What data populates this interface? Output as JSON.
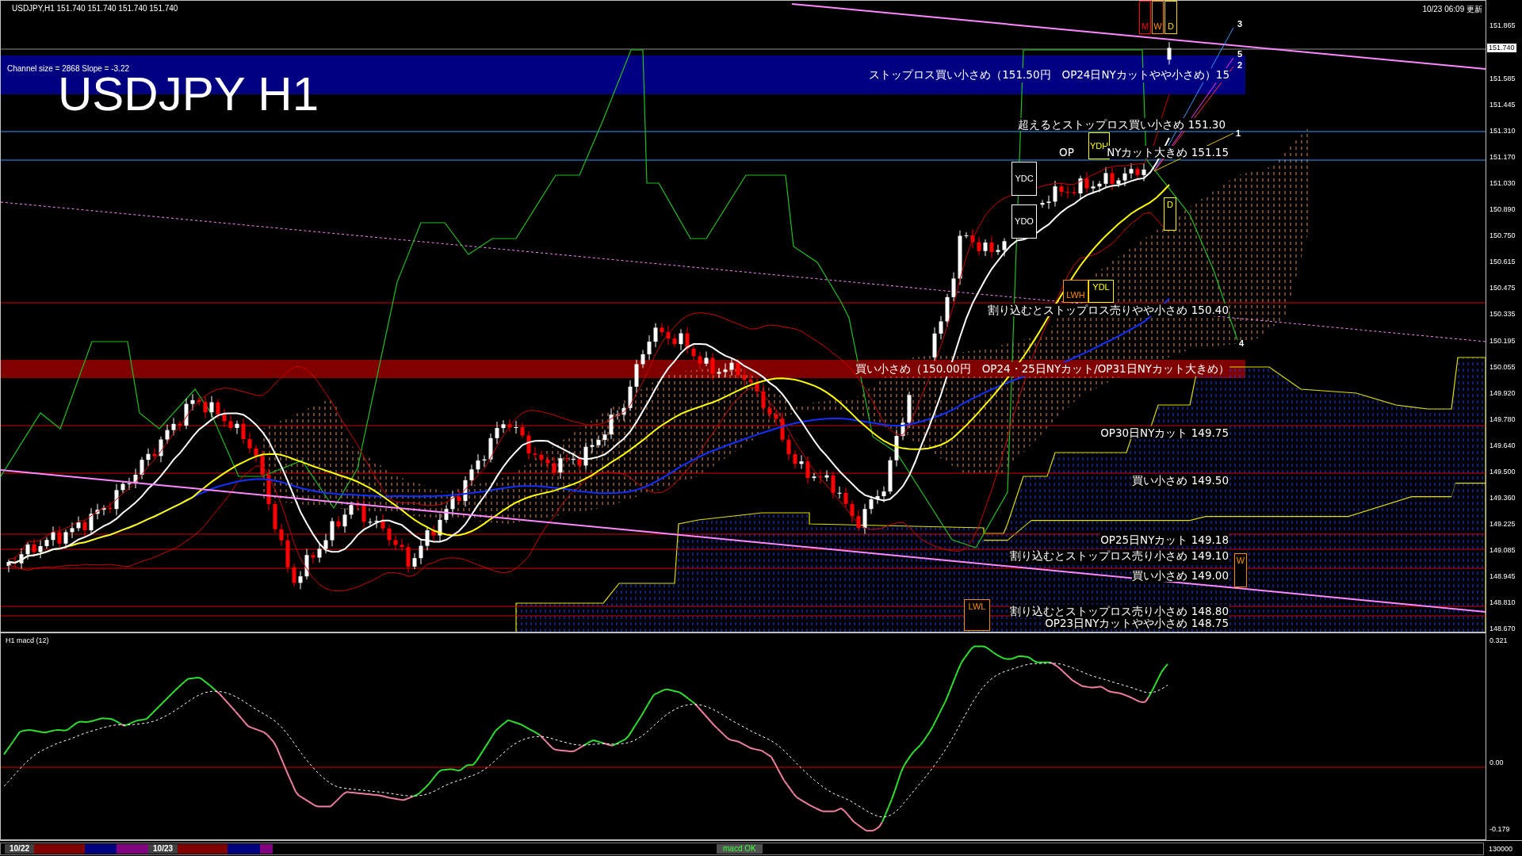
{
  "chart_header": {
    "symbol_line": "USDJPY,H1  151.740 151.740 151.740 151.740",
    "updated": "10/23 06:09 更新"
  },
  "channel_info": "Channel size = 2868 Slope = -3.22",
  "chart_title": "USDJPY H1",
  "zones": [
    {
      "text": "ストップロス買い小さめ（151.50円　OP24日NYカットやや小さめ）15",
      "color": "#000080"
    },
    {
      "text": "買い小さめ（150.00円　OP24・25日NYカット/OP31日NYカット大きめ）",
      "color": "#800000"
    }
  ],
  "annotations": [
    "超えるとストップロス買い小さめ 151.30",
    "OP",
    "NYカット大きめ 151.15",
    "割り込むとストップロス売りやや小さめ 150.40",
    "OP30日NYカット 149.75",
    "買い小さめ 149.50",
    "OP25日NYカット 149.18",
    "割り込むとストップロス売り小さめ 149.10",
    "買い小さめ 149.00",
    "割り込むとストップロス売り小さめ 148.80",
    "OP23日NYカットやや小さめ 148.75"
  ],
  "level_boxes": [
    {
      "label": "M",
      "color": "#ff0000"
    },
    {
      "label": "W",
      "color": "#ff8c00"
    },
    {
      "label": "D",
      "color": "#ffd700"
    },
    {
      "label": "YDH",
      "color": "#ffff00"
    },
    {
      "label": "YDC",
      "color": "#ffffff"
    },
    {
      "label": "YDO",
      "color": "#ffffff"
    },
    {
      "label": "D",
      "color": "#ffff00"
    },
    {
      "label": "YDL",
      "color": "#ffff00"
    },
    {
      "label": "LWH",
      "color": "#ff8c00"
    },
    {
      "label": "W",
      "color": "#ff8c00"
    },
    {
      "label": "LWL",
      "color": "#ff8c00"
    }
  ],
  "line_labels": [
    "3",
    "5",
    "2",
    "1",
    "4"
  ],
  "price_axis": {
    "current_price": "151.740",
    "ticks": [
      "151.865",
      "151.585",
      "151.445",
      "151.310",
      "151.170",
      "151.030",
      "150.890",
      "150.750",
      "150.615",
      "150.475",
      "150.335",
      "150.195",
      "150.055",
      "149.920",
      "149.780",
      "149.640",
      "149.500",
      "149.360",
      "149.225",
      "149.085",
      "148.945",
      "148.810",
      "148.670"
    ]
  },
  "macd_panel": {
    "title": "H1  macd (12)",
    "ticks": [
      "0.321",
      "0.00",
      "-0.179"
    ]
  },
  "bottom_bar": {
    "dates": [
      "10/22",
      "10/23"
    ],
    "status": "macd OK",
    "scale": "130000"
  }
}
